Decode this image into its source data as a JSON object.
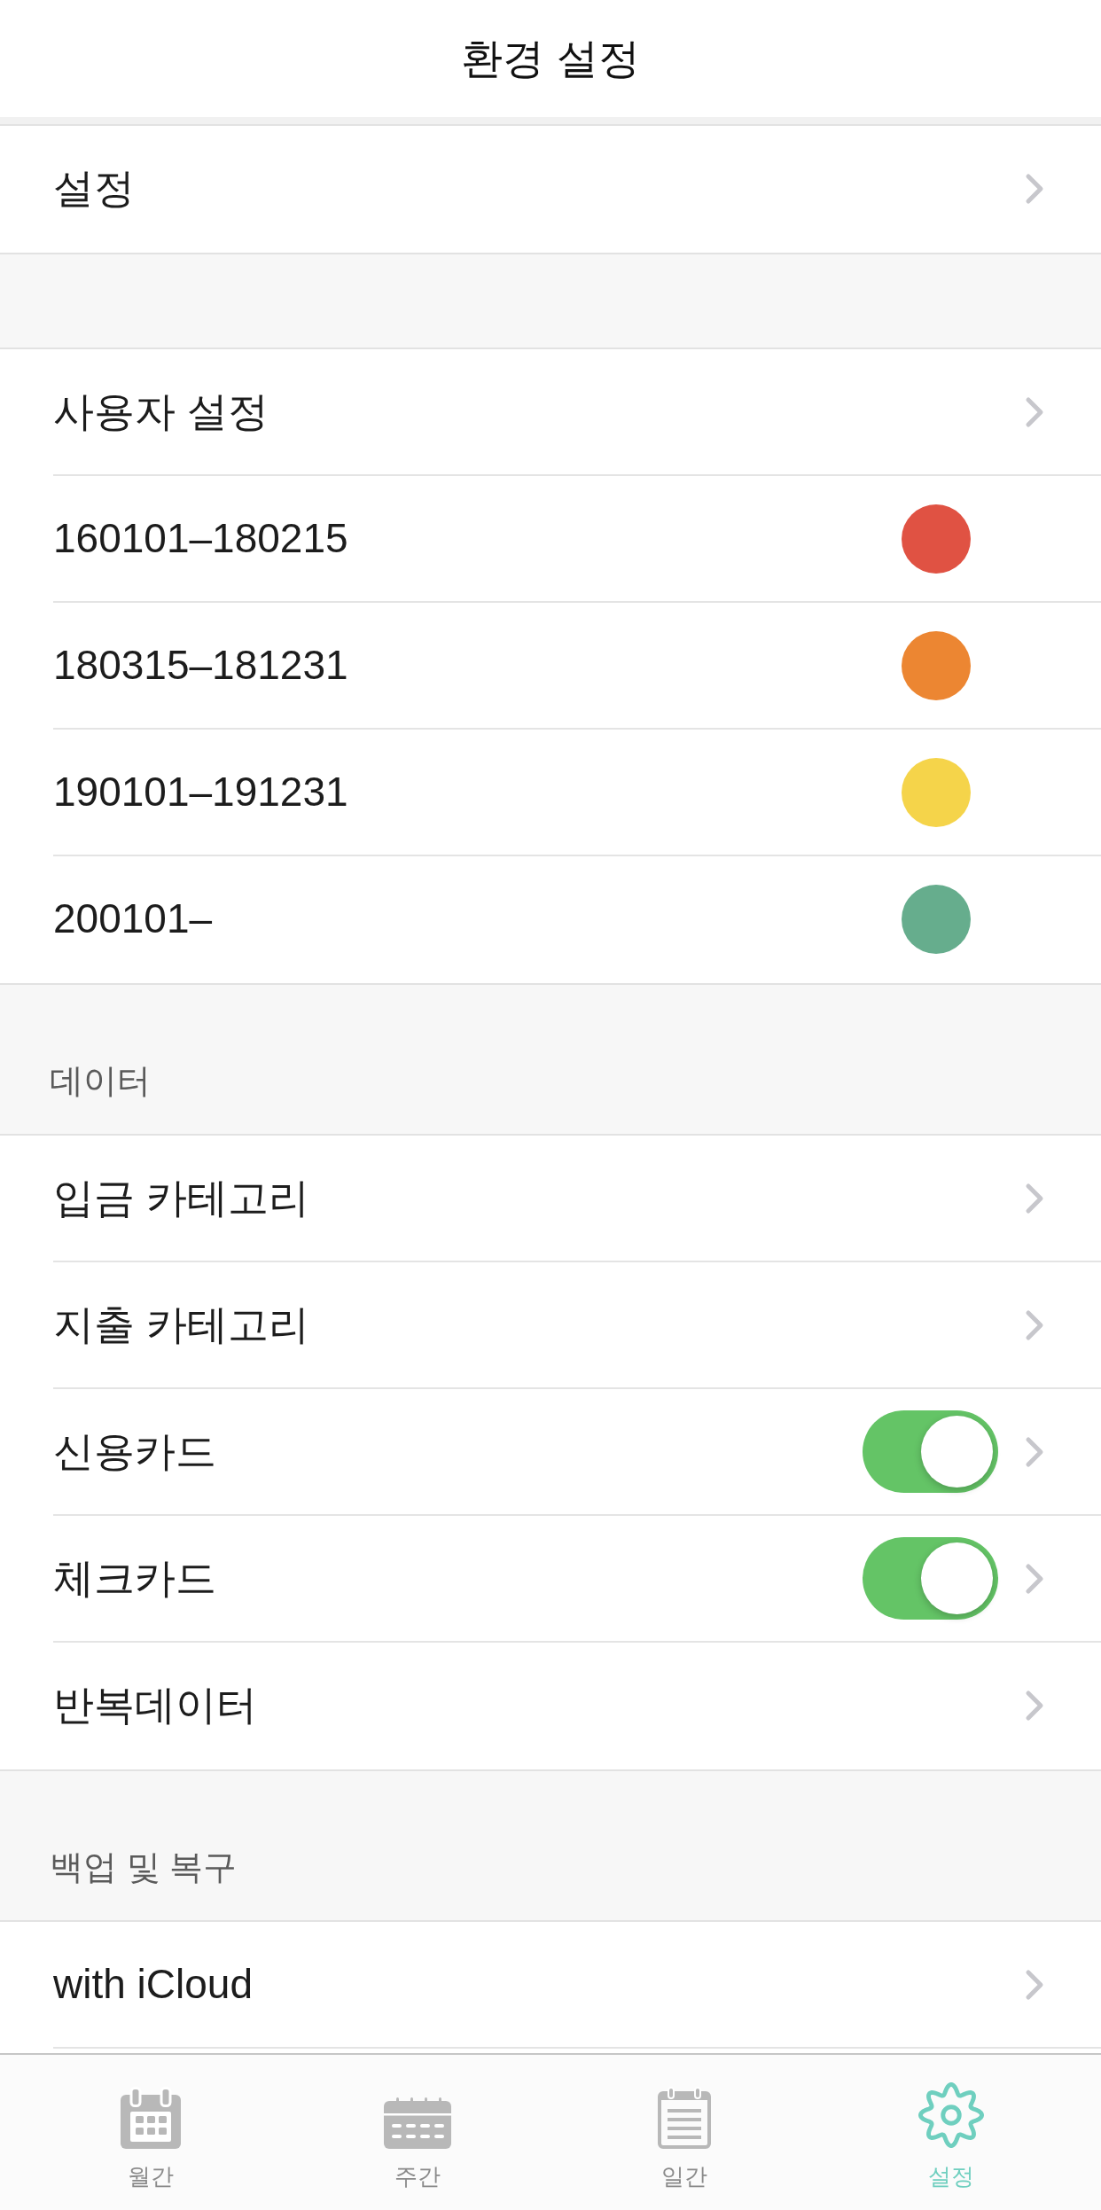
{
  "header": {
    "title": "환경 설정"
  },
  "sections": [
    {
      "rows": [
        {
          "kind": "link",
          "label": "설정"
        }
      ]
    },
    {
      "rows": [
        {
          "kind": "link",
          "label": "사용자 설정"
        },
        {
          "kind": "color",
          "label": "160101–180215",
          "color": "#e05243"
        },
        {
          "kind": "color",
          "label": "180315–181231",
          "color": "#ec8632"
        },
        {
          "kind": "color",
          "label": "190101–191231",
          "color": "#f5d44a"
        },
        {
          "kind": "color",
          "label": "200101–",
          "color": "#66ad8d"
        }
      ]
    },
    {
      "title": "데이터",
      "rows": [
        {
          "kind": "link",
          "label": "입금 카테고리"
        },
        {
          "kind": "link",
          "label": "지출 카테고리"
        },
        {
          "kind": "toggle",
          "label": "신용카드",
          "on": true
        },
        {
          "kind": "toggle",
          "label": "체크카드",
          "on": true
        },
        {
          "kind": "link",
          "label": "반복데이터"
        }
      ]
    },
    {
      "title": "백업 및 복구",
      "rows": [
        {
          "kind": "link",
          "label": "with iCloud"
        }
      ]
    }
  ],
  "tab_bar": {
    "tabs": [
      {
        "label": "월간",
        "selected": false
      },
      {
        "label": "주간",
        "selected": false
      },
      {
        "label": "일간",
        "selected": false
      },
      {
        "label": "설정",
        "selected": true
      }
    ]
  }
}
